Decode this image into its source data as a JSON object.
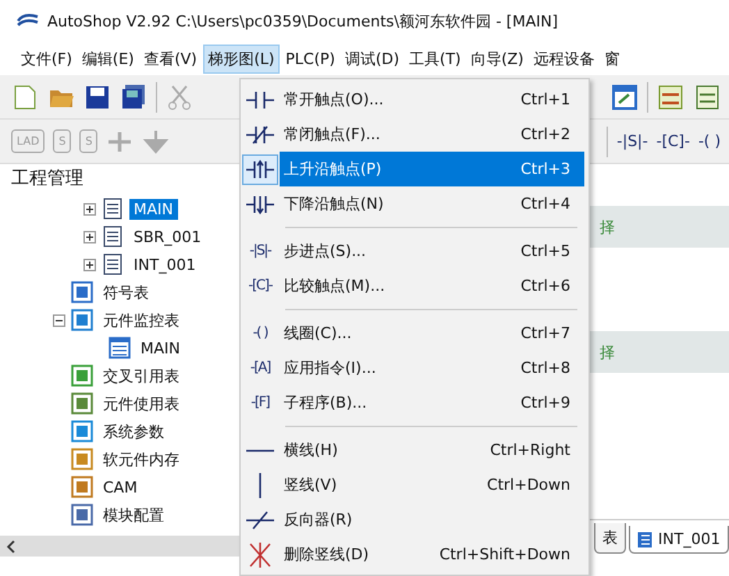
{
  "window": {
    "title": "AutoShop V2.92  C:\\Users\\pc0359\\Documents\\额河东软件园 - [MAIN]"
  },
  "menu_bar": [
    {
      "label": "文件(F)",
      "selected": false
    },
    {
      "label": "编辑(E)",
      "selected": false
    },
    {
      "label": "查看(V)",
      "selected": false
    },
    {
      "label": "梯形图(L)",
      "selected": true
    },
    {
      "label": "PLC(P)",
      "selected": false
    },
    {
      "label": "调试(D)",
      "selected": false
    },
    {
      "label": "工具(T)",
      "selected": false
    },
    {
      "label": "向导(Z)",
      "selected": false
    },
    {
      "label": "远程设备",
      "selected": false
    },
    {
      "label": "窗",
      "selected": false
    }
  ],
  "toolbar2": {
    "left": [
      "LAD",
      "S",
      "S"
    ],
    "right": [
      "-|S|-",
      "-[C]-",
      "-( )"
    ]
  },
  "project_panel": {
    "title": "工程管理",
    "program_blocks": [
      {
        "label": "MAIN",
        "selected": true,
        "expanded": false
      },
      {
        "label": "SBR_001",
        "selected": false,
        "expanded": false
      },
      {
        "label": "INT_001",
        "selected": false,
        "expanded": false
      }
    ],
    "items": [
      {
        "label": "符号表",
        "kind": "symbols"
      },
      {
        "label": "元件监控表",
        "kind": "monitor",
        "expanded": true,
        "children": [
          {
            "label": "MAIN",
            "kind": "table"
          }
        ]
      },
      {
        "label": "交叉引用表",
        "kind": "crossref"
      },
      {
        "label": "元件使用表",
        "kind": "usage"
      },
      {
        "label": "系统参数",
        "kind": "params"
      },
      {
        "label": "软元件内存",
        "kind": "memory"
      },
      {
        "label": "CAM",
        "kind": "cam"
      },
      {
        "label": "模块配置",
        "kind": "module"
      }
    ]
  },
  "editor": {
    "rows": [
      {
        "text": "择",
        "kind": "band"
      },
      {
        "kind": "blank"
      },
      {
        "text": "择",
        "kind": "band"
      },
      {
        "kind": "blank"
      }
    ],
    "tabs": [
      {
        "label": "表",
        "selected": false
      },
      {
        "label": "INT_001",
        "selected": true
      }
    ]
  },
  "dropdown": [
    {
      "kind": "no",
      "label": "常开触点(O)...",
      "shortcut": "Ctrl+1",
      "selected": false
    },
    {
      "kind": "nc",
      "label": "常闭触点(F)...",
      "shortcut": "Ctrl+2",
      "selected": false
    },
    {
      "kind": "rise",
      "label": "上升沿触点(P)",
      "shortcut": "Ctrl+3",
      "selected": true
    },
    {
      "kind": "fall",
      "label": "下降沿触点(N)",
      "shortcut": "Ctrl+4",
      "selected": false
    },
    {
      "kind": "separator"
    },
    {
      "kind": "glyph",
      "glyph": "-|S|-",
      "label": "步进点(S)...",
      "shortcut": "Ctrl+5",
      "selected": false
    },
    {
      "kind": "glyph",
      "glyph": "-[C]-",
      "label": "比较触点(M)...",
      "shortcut": "Ctrl+6",
      "selected": false
    },
    {
      "kind": "separator"
    },
    {
      "kind": "glyph",
      "glyph": "-( )",
      "label": "线圈(C)...",
      "shortcut": "Ctrl+7",
      "selected": false
    },
    {
      "kind": "glyph",
      "glyph": "-[A]",
      "label": "应用指令(I)...",
      "shortcut": "Ctrl+8",
      "selected": false
    },
    {
      "kind": "glyph",
      "glyph": "-[F]",
      "label": "子程序(B)...",
      "shortcut": "Ctrl+9",
      "selected": false
    },
    {
      "kind": "separator"
    },
    {
      "kind": "hline",
      "label": "横线(H)",
      "shortcut": "Ctrl+Right",
      "selected": false
    },
    {
      "kind": "vline",
      "label": "竖线(V)",
      "shortcut": "Ctrl+Down",
      "selected": false
    },
    {
      "kind": "inverter",
      "label": "反向器(R)",
      "selected": false
    },
    {
      "kind": "delete",
      "label": "删除竖线(D)",
      "shortcut": "Ctrl+Shift+Down",
      "selected": false
    }
  ]
}
